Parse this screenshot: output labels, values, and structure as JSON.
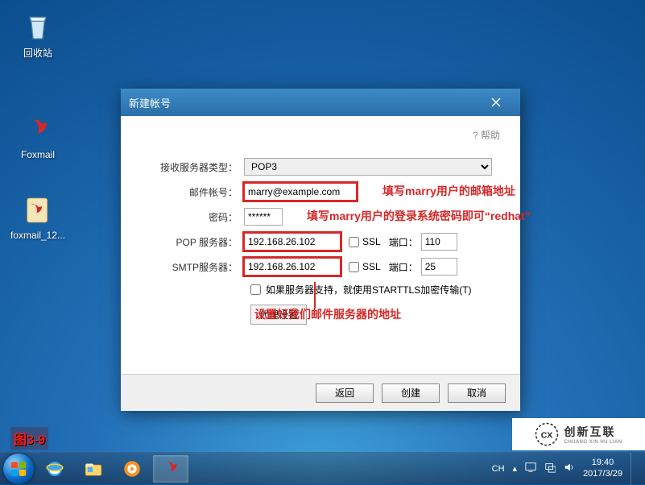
{
  "desktop": {
    "icons": {
      "recycle_bin": "回收站",
      "foxmail": "Foxmail",
      "foxmail_zip": "foxmail_12..."
    }
  },
  "dialog": {
    "title": "新建帐号",
    "help": "? 帮助",
    "labels": {
      "server_type": "接收服务器类型：",
      "email_account": "邮件帐号：",
      "password": "密码：",
      "pop_server": "POP 服务器：",
      "smtp_server": "SMTP服务器：",
      "ssl": "SSL",
      "port": "端口：",
      "starttls": "如果服务器支持，就使用STARTTLS加密传输(T)",
      "proxy_settings": "代理设置"
    },
    "values": {
      "server_type_selected": "POP3",
      "email_account": "marry@example.com",
      "password": "******",
      "pop_server": "192.168.26.102",
      "pop_port": "110",
      "smtp_server": "192.168.26.102",
      "smtp_port": "25"
    },
    "buttons": {
      "back": "返回",
      "create": "创建",
      "cancel": "取消"
    }
  },
  "annotations": {
    "email": "填写marry用户的邮箱地址",
    "password": "填写marry用户的登录系统密码即可“redhat”",
    "server": "设置好我们邮件服务器的地址"
  },
  "figure_label": "图3-9",
  "watermark": {
    "brand": "创新互联",
    "sub": "CHUANG XIN HU LIAN"
  },
  "taskbar": {
    "systray": {
      "ime": "CH",
      "time": "19:40",
      "date": "2017/3/29"
    }
  }
}
